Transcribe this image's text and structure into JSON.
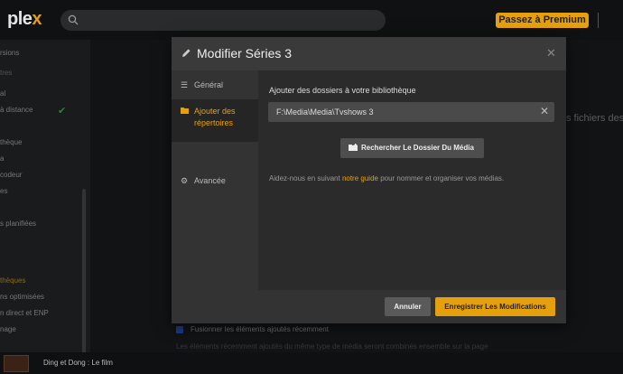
{
  "topbar": {
    "logo_text": "ple",
    "logo_accent": "x",
    "premium_label": "Passez à Premium"
  },
  "sidebar": {
    "items": [
      "rsions",
      "tres",
      "al",
      "à distance",
      "thèque",
      "a",
      "codeur",
      "es",
      "s planifiées",
      "thèques",
      "ns optimisées",
      "n direct et ENP",
      "nage"
    ]
  },
  "background": {
    "right_fragment": "s fichiers des",
    "checkbox_label": "Fusionner les éléments ajoutés récemment",
    "faint_text": "Les éléments récemment ajoutés du même type de média seront combinés ensemble sur la page"
  },
  "player": {
    "title": "Ding et Dong : Le film"
  },
  "modal": {
    "title": "Modifier Séries 3",
    "nav": [
      {
        "label": "Général",
        "icon": "sliders-icon"
      },
      {
        "label": "Ajouter des répertoires",
        "icon": "folder-open-icon"
      },
      {
        "label": "Avancée",
        "icon": "gear-icon"
      }
    ],
    "content": {
      "heading": "Ajouter des dossiers à votre bibliothèque",
      "folder_path": "F:\\Media\\Media\\Tvshows 3",
      "browse_label": "Rechercher Le Dossier Du Média",
      "help_prefix": "Aidez-nous en suivant ",
      "help_link": "notre guide",
      "help_suffix": " pour nommer et organiser vos médias."
    },
    "footer": {
      "cancel_label": "Annuler",
      "save_label": "Enregistrer Les Modifications"
    }
  },
  "colors": {
    "accent": "#e5a00d",
    "background": "#191a1c"
  }
}
